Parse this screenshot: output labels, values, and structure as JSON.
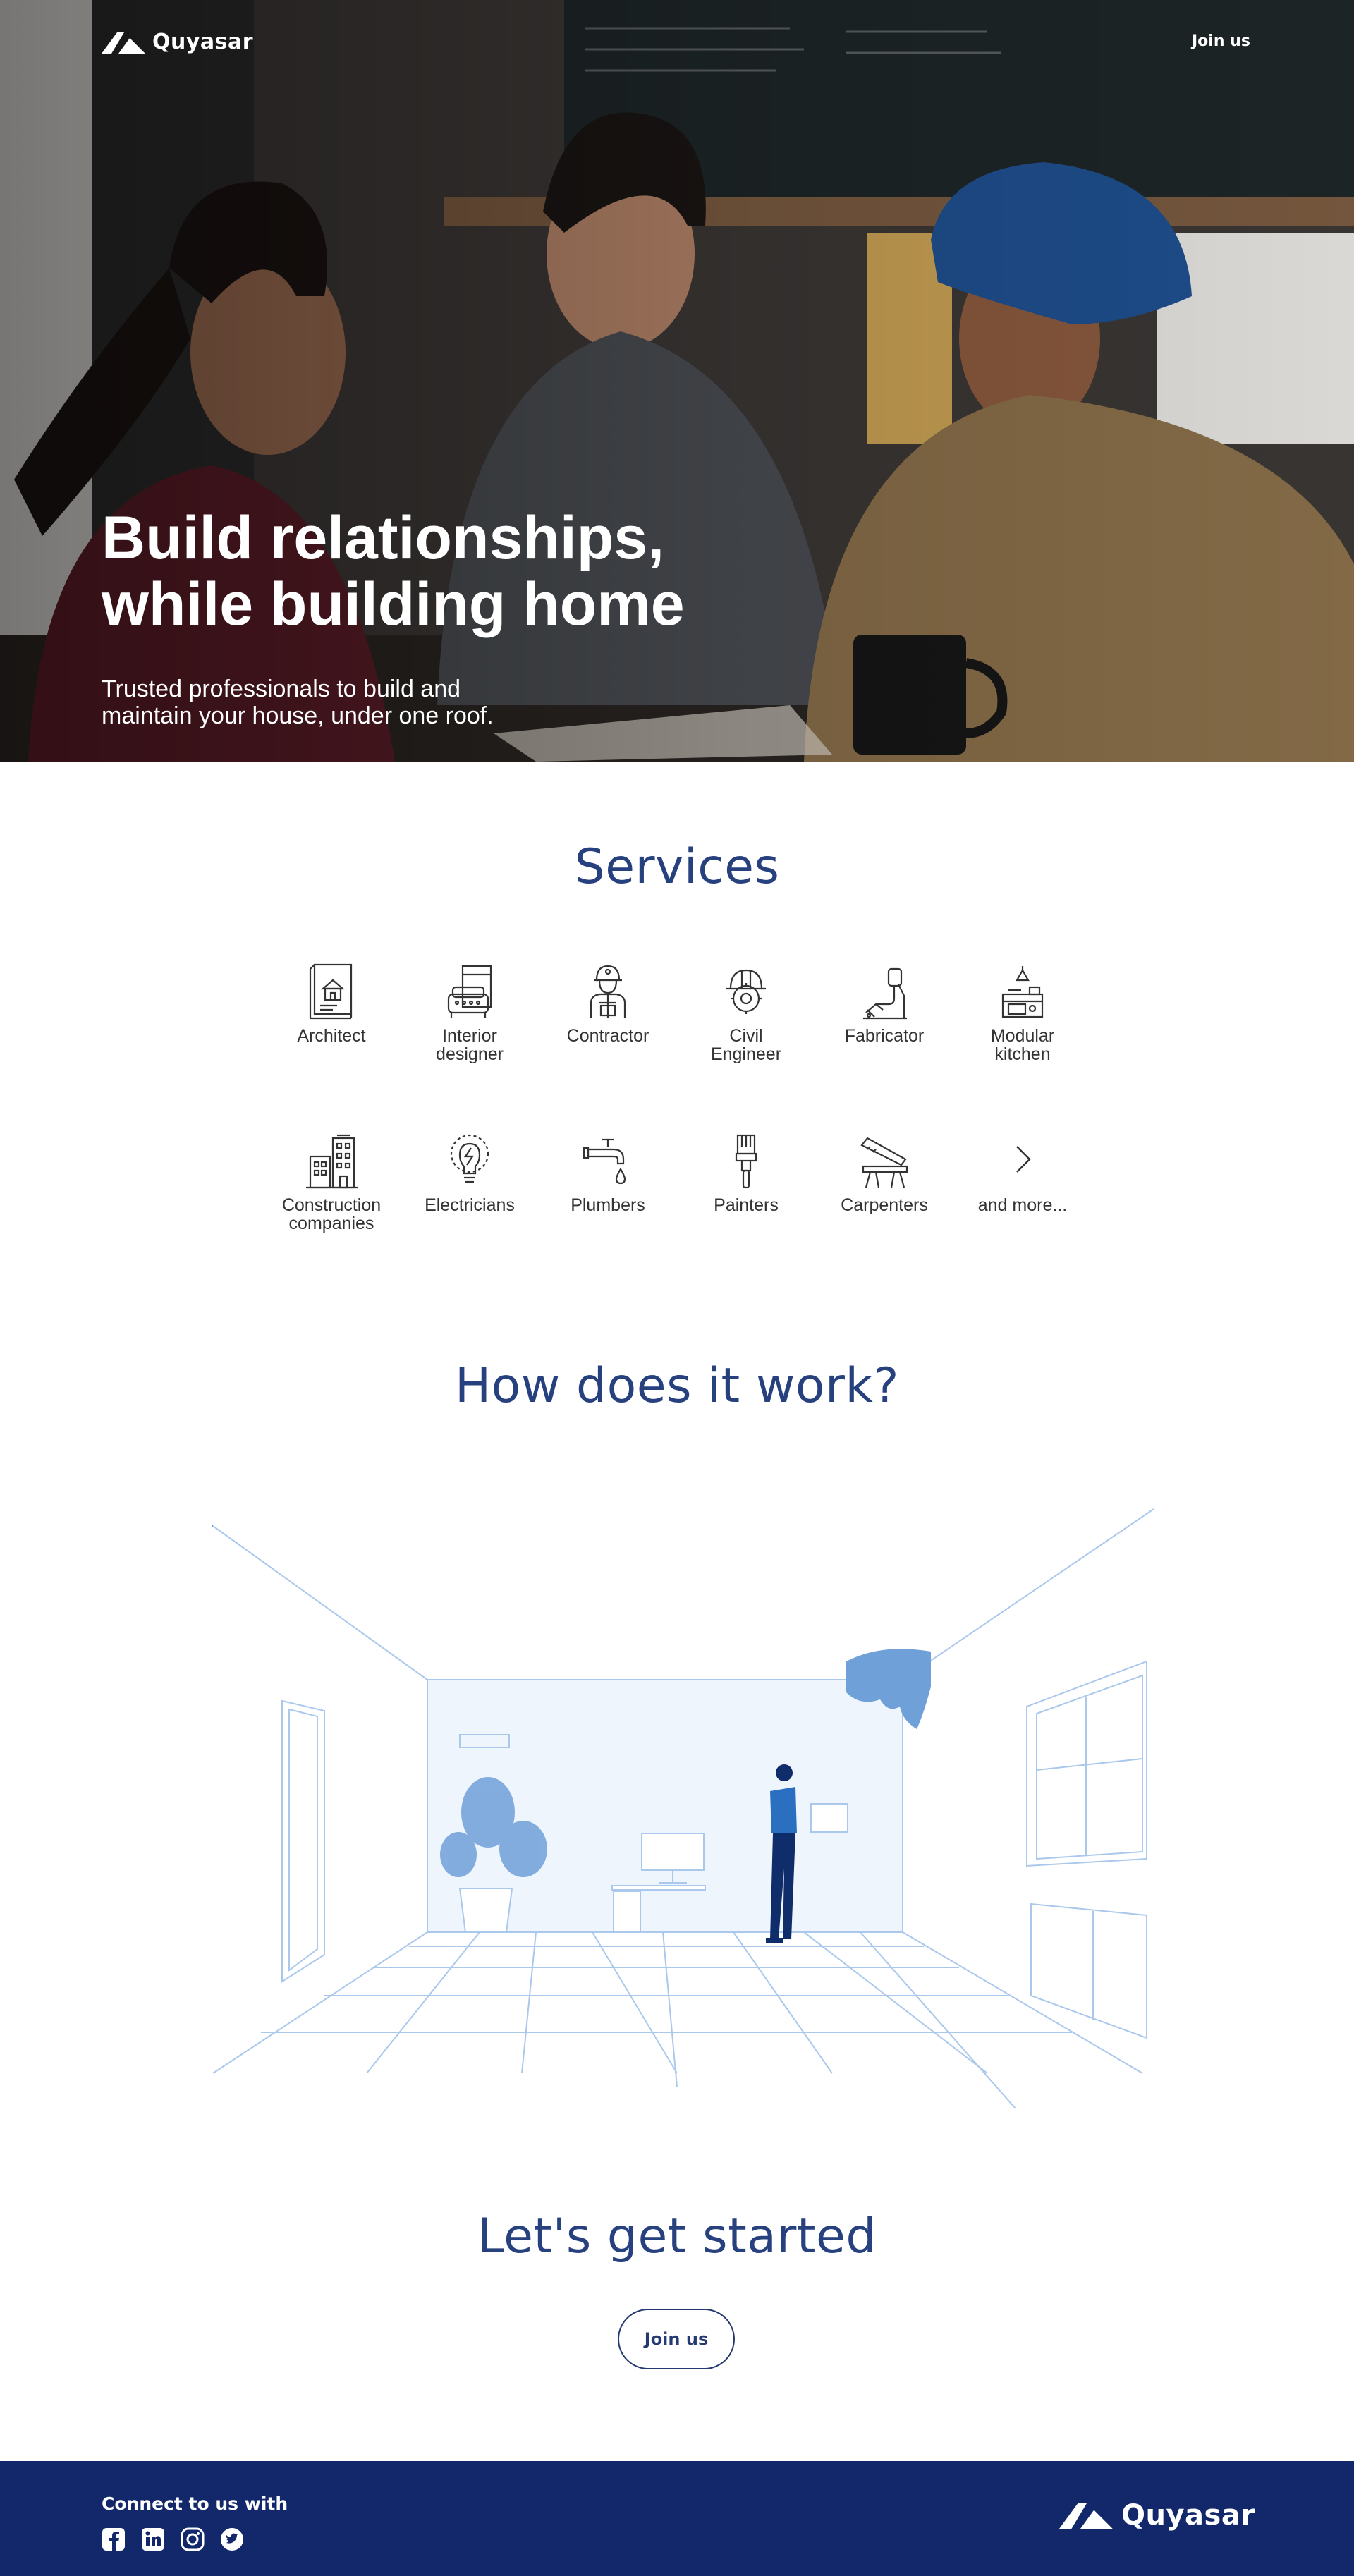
{
  "header": {
    "brand": "Quyasar",
    "join_label": "Join us"
  },
  "hero": {
    "title_line1": "Build relationships,",
    "title_line2": "while building home",
    "subtitle_line1": "Trusted professionals to build and",
    "subtitle_line2": "maintain your house, under one roof."
  },
  "services": {
    "title": "Services",
    "items": [
      {
        "label_line1": "Architect",
        "label_line2": "",
        "icon": "blueprint-house-icon"
      },
      {
        "label_line1": "Interior",
        "label_line2": "designer",
        "icon": "sofa-plan-icon"
      },
      {
        "label_line1": "Contractor",
        "label_line2": "",
        "icon": "worker-hat-icon"
      },
      {
        "label_line1": "Civil",
        "label_line2": "Engineer",
        "icon": "helmet-gear-icon"
      },
      {
        "label_line1": "Fabricator",
        "label_line2": "",
        "icon": "welding-arm-icon"
      },
      {
        "label_line1": "Modular",
        "label_line2": "kitchen",
        "icon": "kitchen-stove-icon"
      },
      {
        "label_line1": "Construction",
        "label_line2": "companies",
        "icon": "buildings-icon"
      },
      {
        "label_line1": "Electricians",
        "label_line2": "",
        "icon": "bulb-bolt-icon"
      },
      {
        "label_line1": "Plumbers",
        "label_line2": "",
        "icon": "tap-drop-icon"
      },
      {
        "label_line1": "Painters",
        "label_line2": "",
        "icon": "paint-brush-icon"
      },
      {
        "label_line1": "Carpenters",
        "label_line2": "",
        "icon": "saw-bench-icon"
      },
      {
        "label_line1": "and more...",
        "label_line2": "",
        "icon": "chevron-right-icon"
      }
    ]
  },
  "how": {
    "title": "How does it work?"
  },
  "cta": {
    "title": "Let's get started",
    "button": "Join us"
  },
  "footer": {
    "connect": "Connect to us with",
    "socials": [
      "facebook-icon",
      "linkedin-icon",
      "instagram-icon",
      "twitter-icon"
    ],
    "brand": "Quyasar"
  },
  "colors": {
    "navy": "#12286b",
    "title_blue": "#27407e",
    "light_blue": "#a9c8ec",
    "accent_blue": "#6fa0d8"
  }
}
